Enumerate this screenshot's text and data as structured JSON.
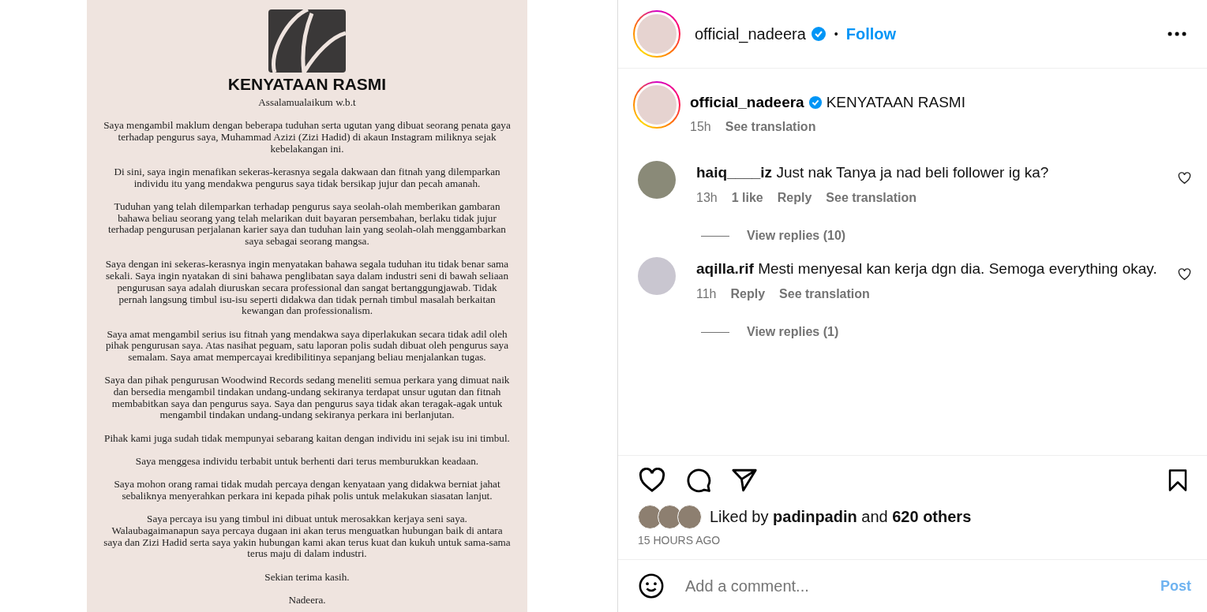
{
  "post_image": {
    "title": "KENYATAAN RASMI",
    "paragraphs": [
      "Assalamualaikum w.b.t",
      "Saya mengambil maklum dengan beberapa tuduhan serta ugutan yang dibuat seorang penata gaya terhadap pengurus saya, Muhammad Azizi (Zizi Hadid) di akaun Instagram miliknya sejak kebelakangan ini.",
      "Di sini, saya ingin menafikan sekeras-kerasnya segala dakwaan dan fitnah yang dilemparkan individu itu yang mendakwa pengurus saya tidak bersikap jujur dan pecah amanah.",
      "Tuduhan yang telah dilemparkan terhadap pengurus saya seolah-olah memberikan gambaran bahawa beliau seorang yang telah melarikan duit bayaran persembahan, berlaku tidak jujur terhadap pengurusan perjalanan karier saya dan tuduhan lain yang seolah-olah menggambarkan saya sebagai seorang mangsa.",
      "Saya dengan ini sekeras-kerasnya ingin menyatakan bahawa segala tuduhan itu tidak benar sama sekali. Saya ingin nyatakan di sini bahawa penglibatan saya dalam industri seni di bawah seliaan pengurusan saya adalah diuruskan secara professional dan sangat bertanggungjawab. Tidak pernah langsung timbul isu-isu seperti didakwa dan tidak pernah timbul masalah berkaitan kewangan dan professionalism.",
      "Saya amat mengambil serius isu fitnah yang mendakwa saya diperlakukan secara tidak adil oleh pihak pengurusan saya. Atas nasihat peguam, satu laporan polis sudah dibuat oleh pengurus saya semalam. Saya amat mempercayai kredibilitinya sepanjang beliau menjalankan tugas.",
      "Saya dan pihak pengurusan Woodwind Records sedang meneliti semua perkara yang dimuat naik dan bersedia mengambil tindakan undang-undang sekiranya terdapat unsur ugutan dan fitnah membabitkan saya dan pengurus saya. Saya dan pengurus saya tidak akan teragak-agak untuk mengambil tindakan undang-undang sekiranya perkara ini berlanjutan.",
      "Pihak kami juga sudah tidak mempunyai sebarang kaitan dengan individu ini sejak isu ini timbul.",
      "Saya menggesa individu terbabit untuk berhenti dari terus memburukkan keadaan.",
      "Saya mohon orang ramai tidak mudah percaya dengan kenyataan yang didakwa berniat jahat sebaliknya menyerahkan perkara ini kepada pihak polis untuk melakukan siasatan lanjut.",
      "Saya percaya isu yang timbul ini dibuat untuk merosakkan kerjaya seni saya. Walaubagaimanapun saya percaya dugaan ini akan terus menguatkan hubungan baik di antara saya dan Zizi Hadid serta saya yakin hubungan kami akan terus kuat dan kukuh untuk sama-sama terus maju di dalam industri.",
      "Sekian terima kasih.",
      "Nadeera."
    ]
  },
  "header": {
    "username": "official_nadeera",
    "separator": "•",
    "follow": "Follow"
  },
  "caption": {
    "username": "official_nadeera",
    "text": "KENYATAAN RASMI",
    "time": "15h",
    "translate": "See translation"
  },
  "comments": [
    {
      "username": "haiq____iz",
      "text": "Just nak Tanya ja nad beli follower ig ka?",
      "time": "13h",
      "likes": "1 like",
      "reply": "Reply",
      "translate": "See translation",
      "view_replies": "View replies (10)"
    },
    {
      "username": "aqilla.rif",
      "text": "Mesti menyesal kan kerja dgn dia. Semoga everything okay.",
      "time": "11h",
      "reply": "Reply",
      "translate": "See translation",
      "view_replies": "View replies (1)"
    }
  ],
  "liked_by": "Liked by **padinpadin** and **620 others**",
  "timestamp": "15 HOURS AGO",
  "comment_box": {
    "placeholder": "Add a comment...",
    "post": "Post",
    "post_disabled": true
  }
}
